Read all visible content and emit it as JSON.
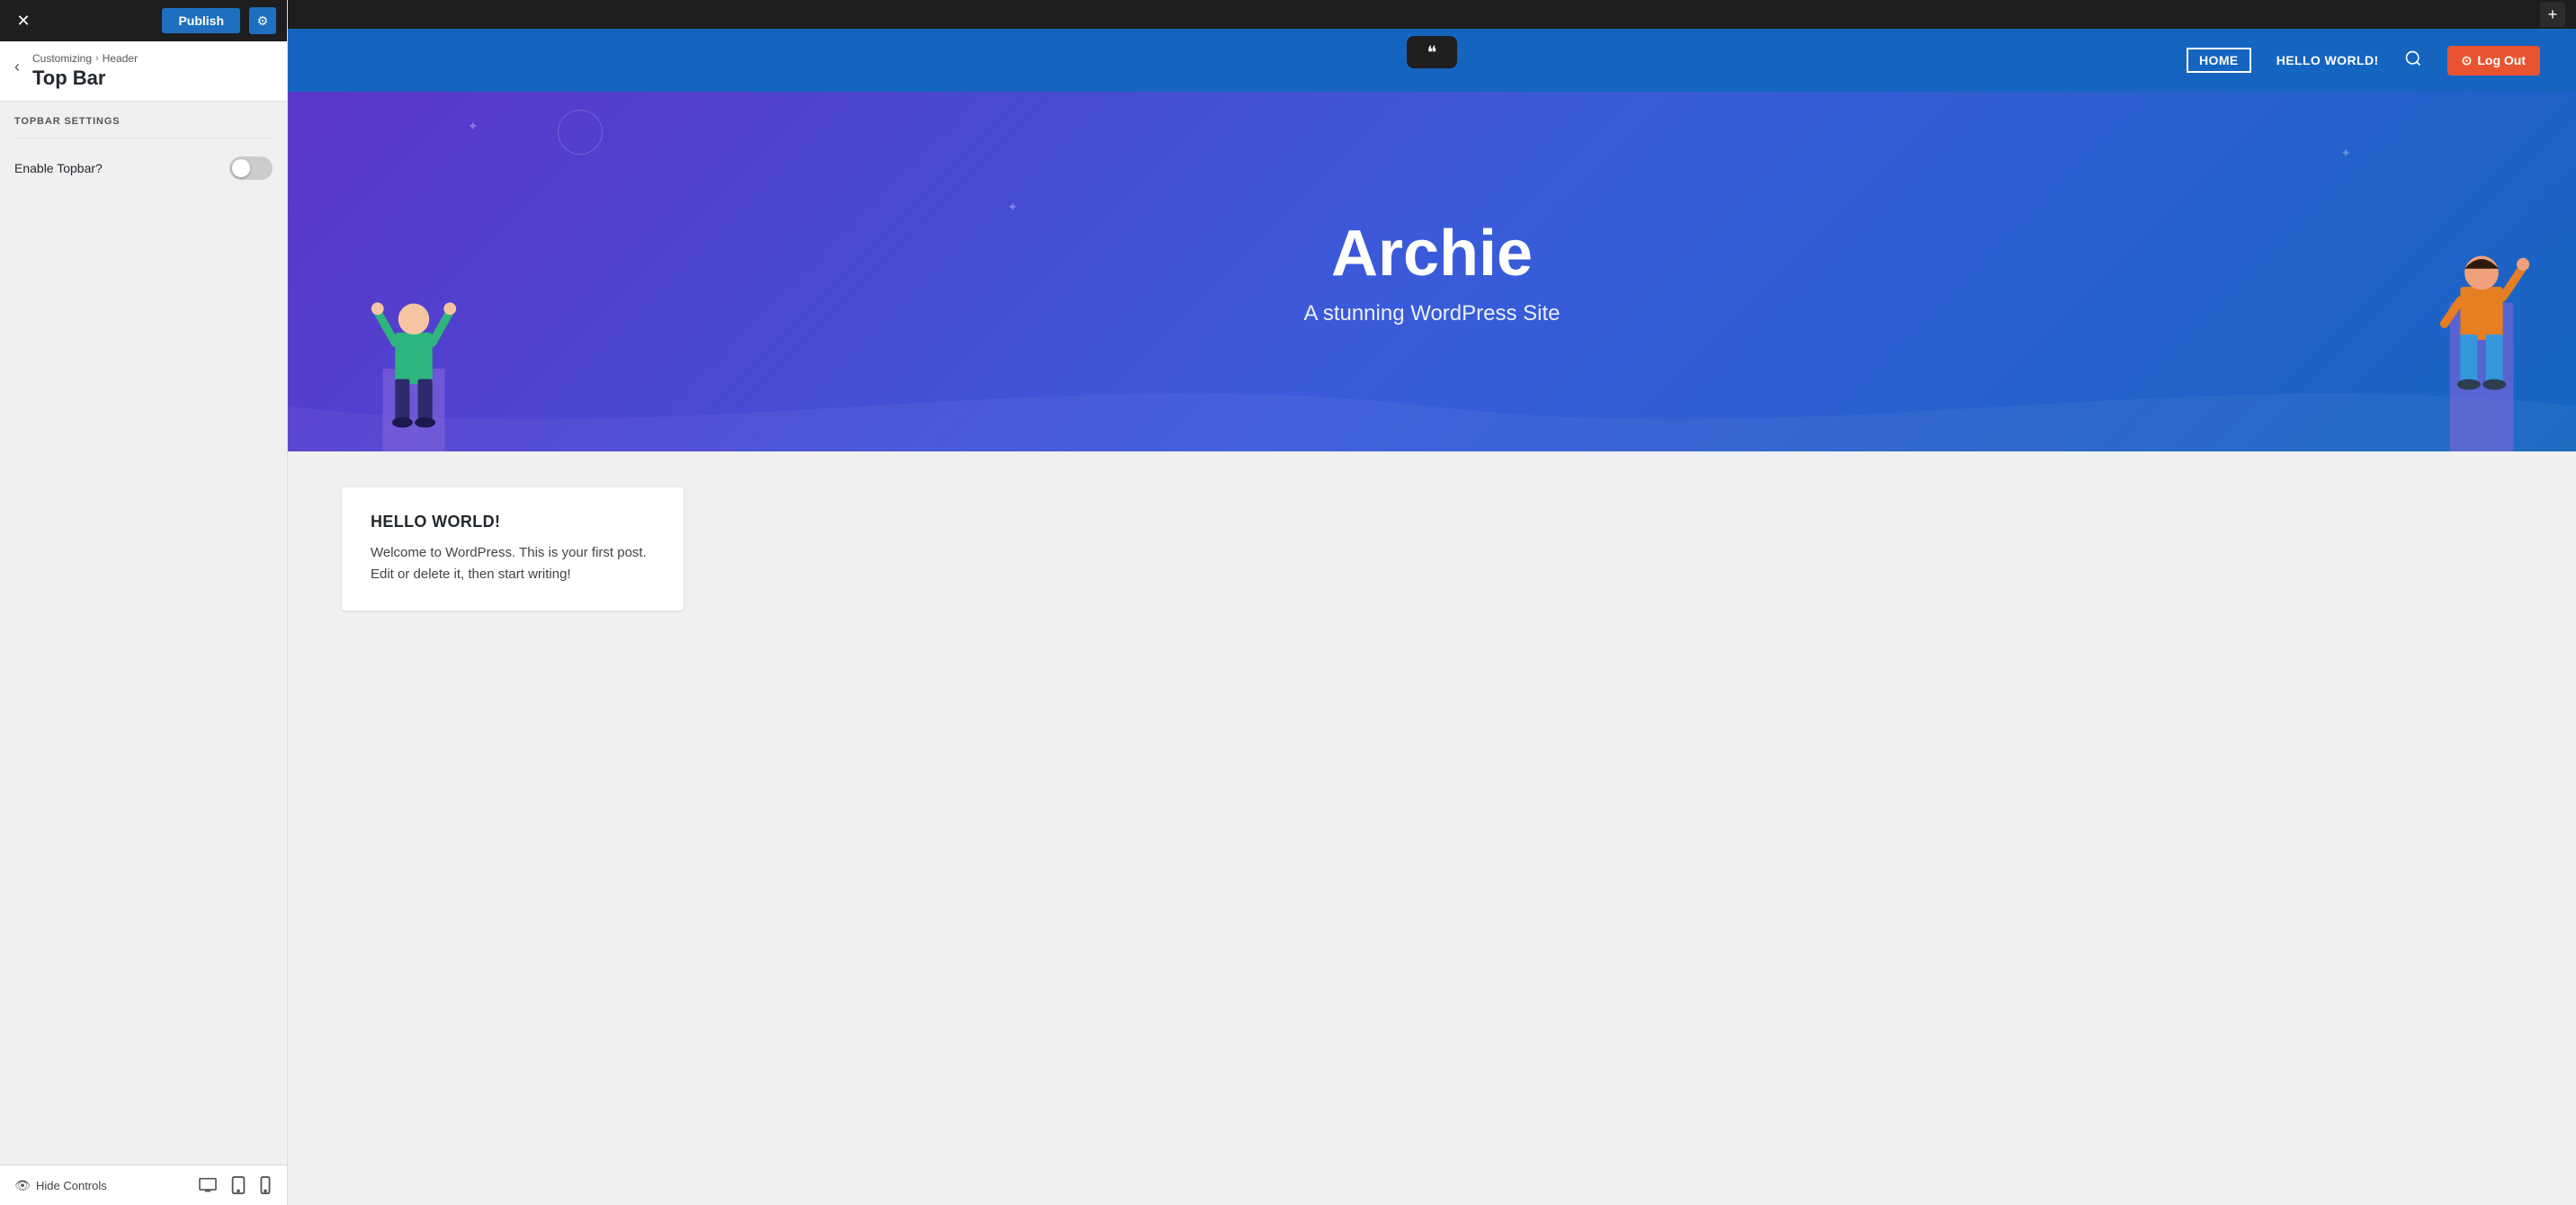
{
  "toolbar": {
    "publish_label": "Publish",
    "close_icon": "✕",
    "gear_icon": "⚙"
  },
  "breadcrumb": {
    "back_icon": "‹",
    "path_part1": "Customizing",
    "path_arrow": "›",
    "path_part2": "Header",
    "title": "Top Bar"
  },
  "settings": {
    "section_label": "TOPBAR SETTINGS",
    "enable_topbar_label": "Enable Topbar?",
    "toggle_state": false
  },
  "bottom_bar": {
    "hide_controls_label": "Hide Controls",
    "eye_icon": "👁",
    "desktop_icon": "🖥",
    "tablet_icon": "⊡",
    "mobile_icon": "📱"
  },
  "admin_bar": {
    "add_icon": "+"
  },
  "site_header": {
    "quote_icon": "❝",
    "nav_items": [
      {
        "label": "HOME",
        "active": true
      },
      {
        "label": "HELLO WORLD!",
        "active": false
      }
    ],
    "search_icon": "🔍",
    "logout_icon": "⊙",
    "logout_label": "Log Out"
  },
  "hero": {
    "title": "Archie",
    "subtitle": "A stunning WordPress Site"
  },
  "blog_card": {
    "title": "HELLO WORLD!",
    "excerpt": "Welcome to WordPress. This is your first post. Edit or delete it, then start writing!"
  }
}
